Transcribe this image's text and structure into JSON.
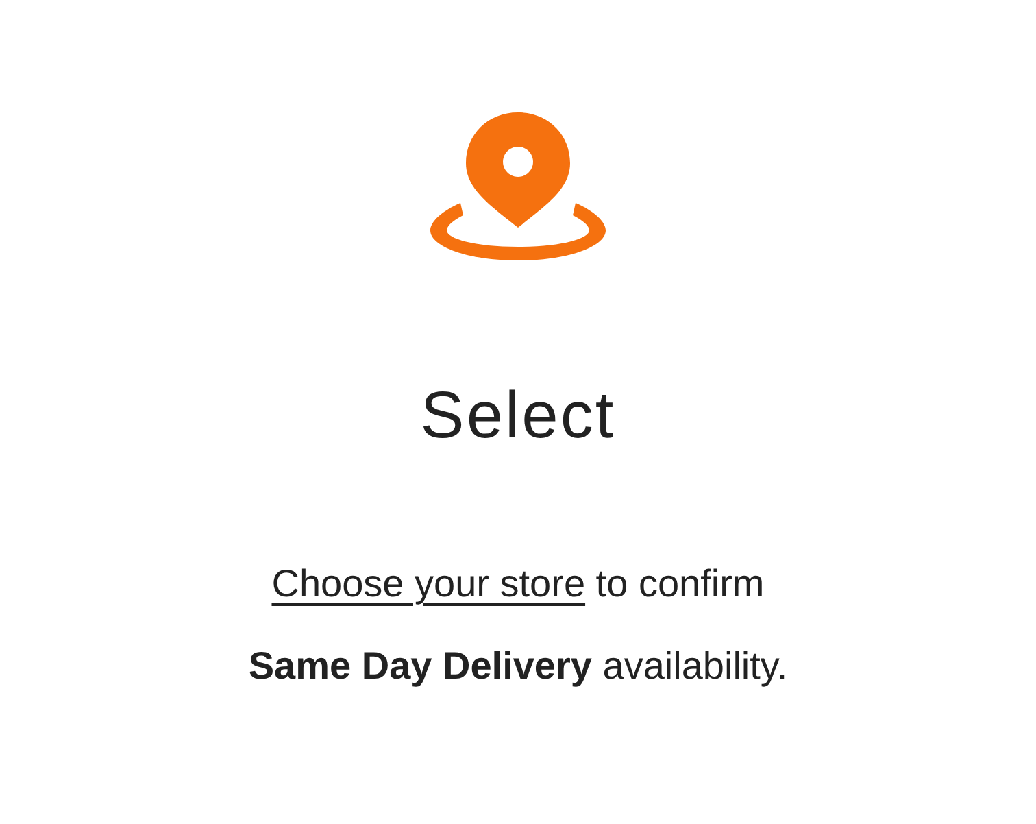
{
  "title": "Select",
  "message": {
    "link": "Choose your store",
    "line_1_rest": " to confirm",
    "line_2": "**Same Day Delivery** availability."
  }
}
